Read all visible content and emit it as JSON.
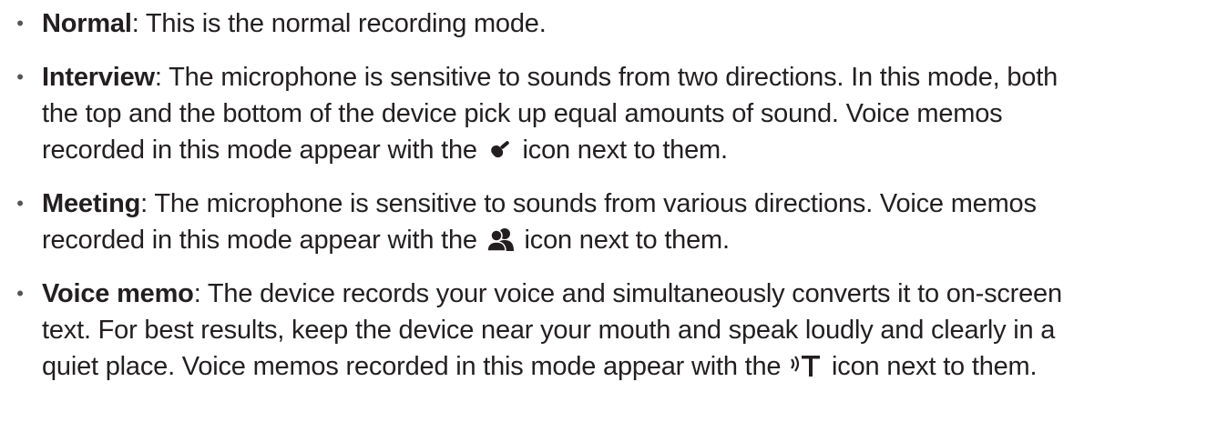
{
  "bullet": "•",
  "items": [
    {
      "term": "Normal",
      "text": ": This is the normal recording mode."
    },
    {
      "term": "Interview",
      "text_line1": ": The microphone is sensitive to sounds from two directions. In this mode, both",
      "text_line2": "the top and the bottom of the device pick up equal amounts of sound. Voice memos",
      "text_before_icon": "recorded in this mode appear with the ",
      "icon": "microphone-icon",
      "text_after_icon": " icon next to them."
    },
    {
      "term": "Meeting",
      "text_line1": ": The microphone is sensitive to sounds from various directions. Voice memos",
      "text_before_icon": "recorded in this mode appear with the ",
      "icon": "people-icon",
      "text_after_icon": " icon next to them."
    },
    {
      "term": "Voice memo",
      "text_line1": ": The device records your voice and simultaneously converts it to on-screen",
      "text_line2": "text. For best results, keep the device near your mouth and speak loudly and clearly in a",
      "text_before_icon": "quiet place. Voice memos recorded in this mode appear with the ",
      "icon": "voice-to-text-icon",
      "text_after_icon": " icon next to them."
    }
  ]
}
